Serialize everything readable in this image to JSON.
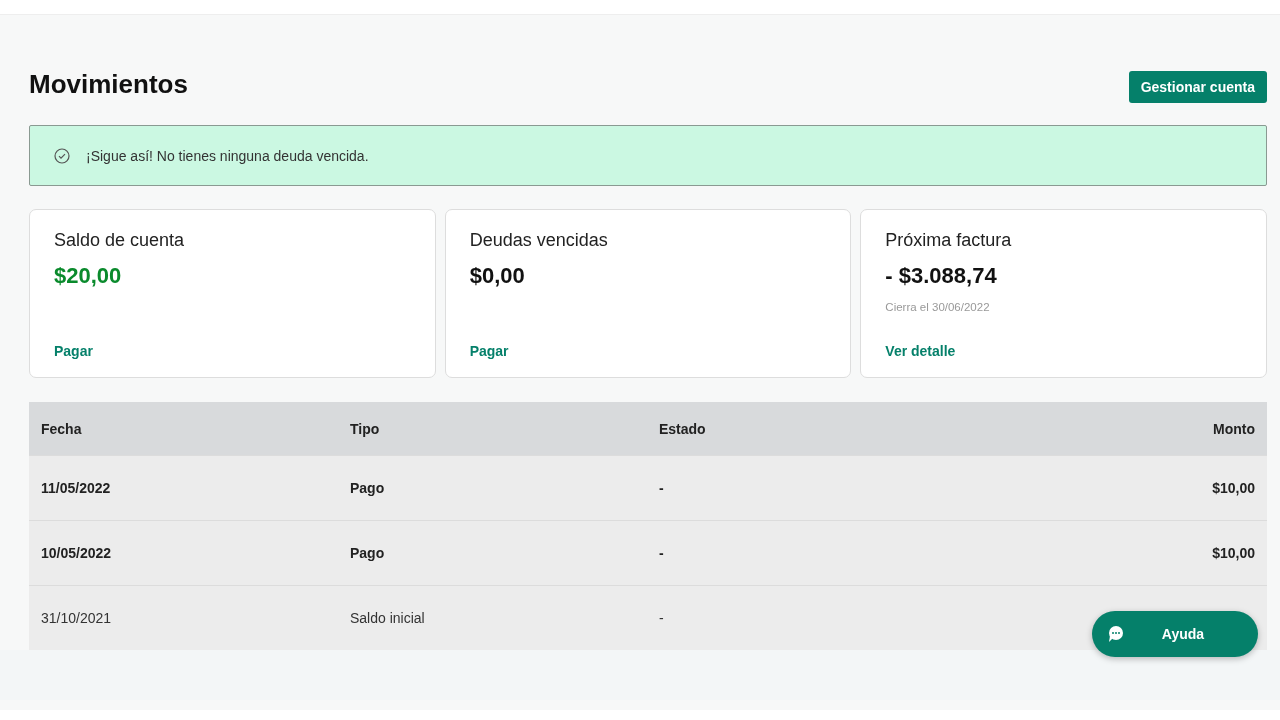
{
  "page": {
    "title": "Movimientos",
    "action": "Gestionar cuenta"
  },
  "banner": {
    "text": "¡Sigue así! No tienes ninguna deuda vencida."
  },
  "cards": [
    {
      "title": "Saldo de cuenta",
      "amount": "$20,00",
      "positive": true,
      "link": "Pagar"
    },
    {
      "title": "Deudas vencidas",
      "amount": "$0,00",
      "positive": false,
      "link": "Pagar"
    },
    {
      "title": "Próxima factura",
      "amount": "- $3.088,74",
      "positive": false,
      "note": "Cierra el 30/06/2022",
      "link": "Ver detalle"
    }
  ],
  "table": {
    "columns": [
      "Fecha",
      "Tipo",
      "Estado",
      "Monto"
    ],
    "rows": [
      {
        "cells": [
          "11/05/2022",
          "Pago",
          "-",
          "$10,00"
        ],
        "bold": true
      },
      {
        "cells": [
          "10/05/2022",
          "Pago",
          "-",
          "$10,00"
        ],
        "bold": true
      },
      {
        "cells": [
          "31/10/2021",
          "Saldo inicial",
          "-"
        ],
        "bold": false
      }
    ]
  },
  "help_button": {
    "label": "Ayuda"
  }
}
